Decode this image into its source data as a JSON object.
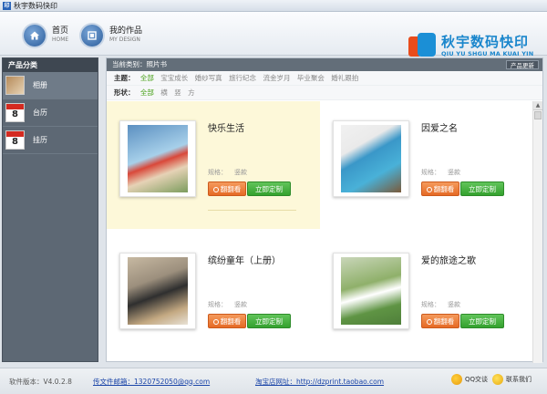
{
  "window": {
    "title": "秋宇数码快印"
  },
  "nav": [
    {
      "label": "首页",
      "sub": "HOME"
    },
    {
      "label": "我的作品",
      "sub": "MY DESIGN"
    }
  ],
  "logo": {
    "cn": "秋宇数码快印",
    "en": "QIU YU SHGU MA KUAI YIN"
  },
  "sidebar": {
    "title": "产品分类",
    "items": [
      {
        "label": "相册"
      },
      {
        "label": "台历"
      },
      {
        "label": "挂历"
      }
    ]
  },
  "content": {
    "current_category": "当前类别：照片书",
    "update_button": "产品更新",
    "filters": {
      "topic": {
        "label": "主题：",
        "options": [
          "全部",
          "宝宝成长",
          "婚纱写真",
          "旅行纪念",
          "流金岁月",
          "毕业聚会",
          "婚礼跟拍"
        ]
      },
      "shape": {
        "label": "形状：",
        "options": [
          "全部",
          "横",
          "竖",
          "方"
        ]
      }
    },
    "products": [
      {
        "name": "快乐生活",
        "spec_label": "规格：",
        "spec_value": "竖款",
        "btn_flip": "翻翻看",
        "btn_order": "立即定制"
      },
      {
        "name": "因爱之名",
        "spec_label": "规格：",
        "spec_value": "竖款",
        "btn_flip": "翻翻看",
        "btn_order": "立即定制"
      },
      {
        "name": "缤纷童年（上册）",
        "spec_label": "规格：",
        "spec_value": "竖款",
        "btn_flip": "翻翻看",
        "btn_order": "立即定制"
      },
      {
        "name": "爱的旅途之歌",
        "spec_label": "规格：",
        "spec_value": "竖款",
        "btn_flip": "翻翻看",
        "btn_order": "立即定制"
      }
    ]
  },
  "footer": {
    "version": "软件版本：V4.0.2.8",
    "mail": "传文件邮箱：1320752050@qq.com",
    "shop": "淘宝店网址：http://dzprint.taobao.com",
    "qq1": "QQ交谈",
    "qq2": "联系我们"
  }
}
